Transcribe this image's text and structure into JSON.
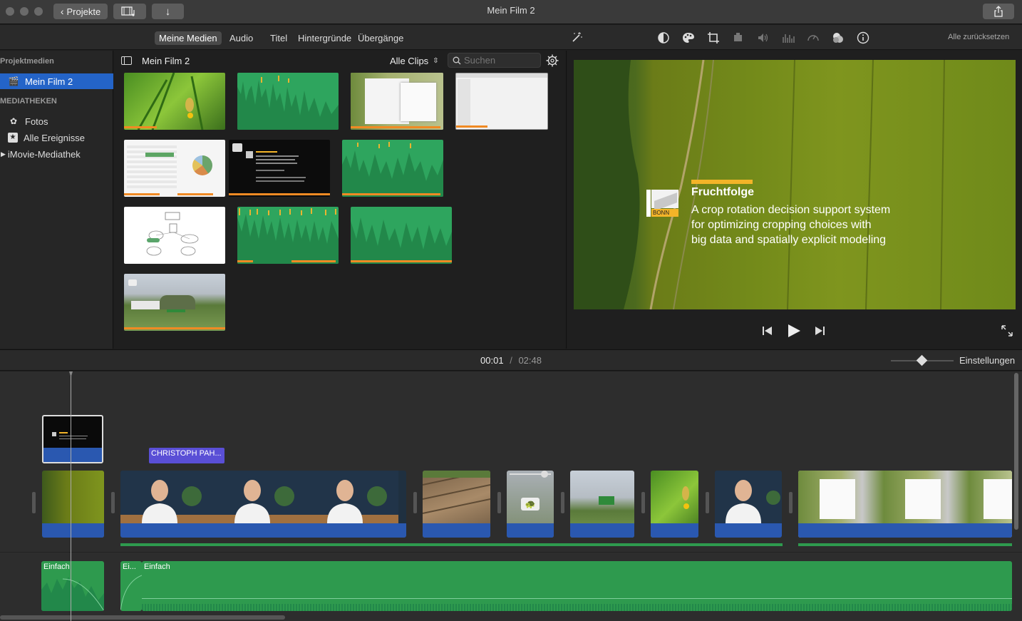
{
  "window": {
    "title": "Mein Film 2",
    "back_button": "Projekte"
  },
  "media_tabs": [
    "Meine Medien",
    "Audio",
    "Titel",
    "Hintergründe",
    "Übergänge"
  ],
  "adjust": {
    "reset_label": "Alle zurücksetzen"
  },
  "sidebar": {
    "project_section": "Projektmedien",
    "project_item": "Mein Film 2",
    "libraries_section": "MEDIATHEKEN",
    "items": [
      "Fotos",
      "Alle Ereignisse",
      "iMovie-Mediathek"
    ]
  },
  "browser": {
    "title": "Mein Film 2",
    "filter": "Alle Clips",
    "search_placeholder": "Suchen"
  },
  "viewer": {
    "slide_title": "Fruchtfolge",
    "slide_lines": [
      "A crop rotation decision support system",
      "for optimizing cropping choices with",
      "big data and spatially explicit modeling"
    ],
    "logo_text": "BONN"
  },
  "timeline": {
    "current_time": "00:01",
    "separator": "/",
    "total_time": "02:48",
    "settings_label": "Einstellungen",
    "title_clip_label": "CHRISTOPH PAH...",
    "audio_labels": [
      "Einfach",
      "Ei...",
      "Einfach"
    ]
  },
  "colors": {
    "selection": "#2464c8",
    "audio_green": "#2e9a4e",
    "video_blue": "#2a58b0",
    "progress_orange": "#f08a24",
    "title_purple": "#5a4fd6"
  }
}
